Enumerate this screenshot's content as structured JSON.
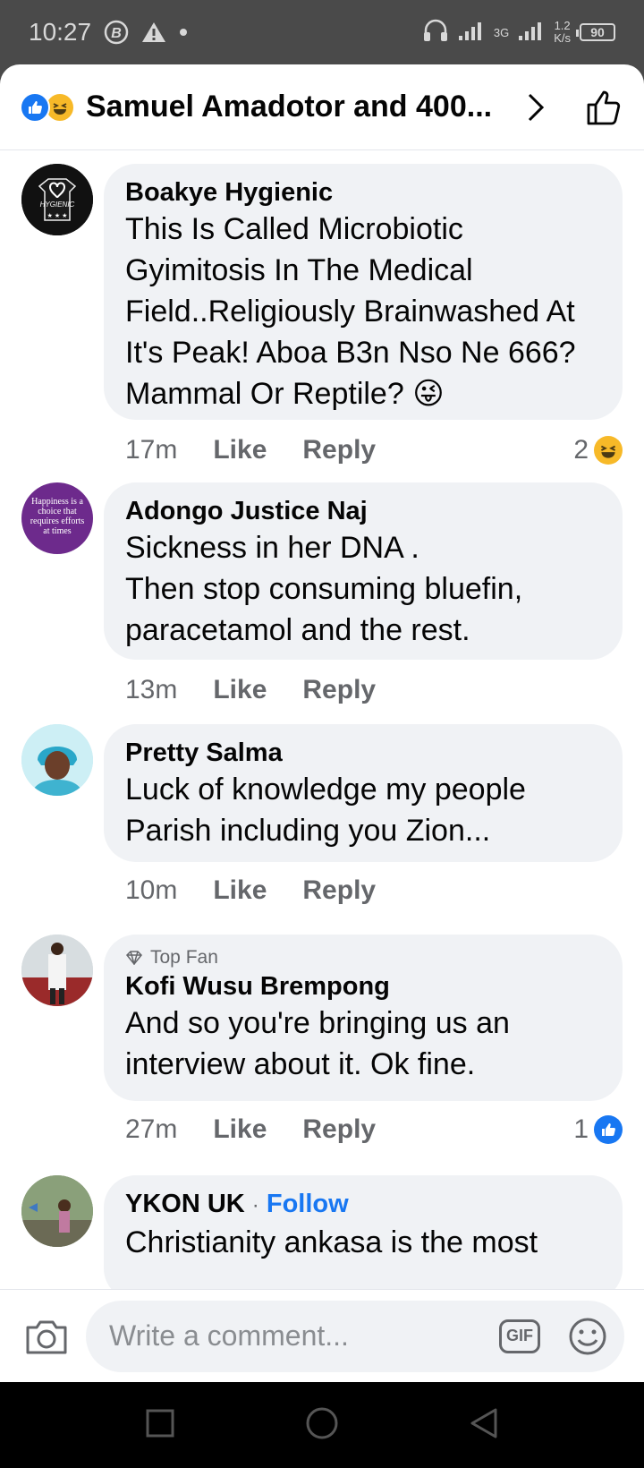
{
  "status_bar": {
    "time": "10:27",
    "network": "3G",
    "speed_value": "1.2",
    "speed_unit": "K/s",
    "battery": "90"
  },
  "header": {
    "title": "Samuel Amadotor and 400..."
  },
  "comments": [
    {
      "author": "Boakye Hygienic",
      "text": "This Is Called Microbiotic Gyimitosis In The Medical Field..Religiously Brainwashed At It's  Peak! Aboa B3n Nso Ne 666? Mammal Or Reptile? 😜",
      "time": "17m",
      "like": "Like",
      "reply": "Reply",
      "reaction_count": "2",
      "reaction_type": "haha",
      "avatar_text": "HYGIENIC"
    },
    {
      "author": "Adongo Justice Naj",
      "text": "Sickness in her DNA .\nThen stop consuming bluefin, paracetamol and the rest.",
      "time": "13m",
      "like": "Like",
      "reply": "Reply",
      "avatar_text": "Happiness is a choice that requires efforts at times"
    },
    {
      "author": "Pretty Salma",
      "text": "Luck of knowledge my people Parish including you Zion...",
      "time": "10m",
      "like": "Like",
      "reply": "Reply"
    },
    {
      "badge": "Top Fan",
      "author": "Kofi Wusu Brempong",
      "text": "And so you're bringing us an interview about it. Ok fine.",
      "time": "27m",
      "like": "Like",
      "reply": "Reply",
      "reaction_count": "1",
      "reaction_type": "like"
    },
    {
      "author": "YKON UK",
      "separator": "·",
      "follow": "Follow",
      "text": "Christianity ankasa is the most"
    }
  ],
  "composer": {
    "placeholder": "Write a comment...",
    "gif": "GIF"
  },
  "colors": {
    "accent": "#1877f2",
    "bubble": "#f0f2f5",
    "muted": "#65676b"
  }
}
